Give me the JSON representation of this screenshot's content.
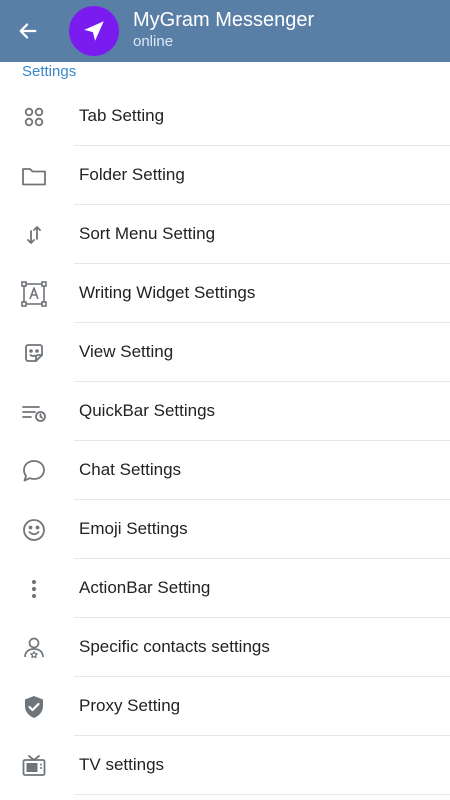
{
  "header": {
    "title": "MyGram Messenger",
    "status": "online",
    "colors": {
      "bar": "#5a7fa6",
      "avatar": "#7a1cf0",
      "section": "#3a87c8"
    }
  },
  "section": {
    "title": "Settings"
  },
  "items": [
    {
      "label": "Tab Setting",
      "icon": "grid-circles-icon"
    },
    {
      "label": "Folder Setting",
      "icon": "folder-icon"
    },
    {
      "label": "Sort Menu Setting",
      "icon": "sort-arrows-icon"
    },
    {
      "label": "Writing Widget Settings",
      "icon": "text-frame-icon"
    },
    {
      "label": "View Setting",
      "icon": "sticker-icon"
    },
    {
      "label": "QuickBar Settings",
      "icon": "list-clock-icon"
    },
    {
      "label": "Chat Settings",
      "icon": "chat-bubble-icon"
    },
    {
      "label": "Emoji Settings",
      "icon": "smile-icon"
    },
    {
      "label": "ActionBar Setting",
      "icon": "more-vertical-icon"
    },
    {
      "label": "Specific contacts settings",
      "icon": "contact-star-icon"
    },
    {
      "label": "Proxy Setting",
      "icon": "shield-check-icon"
    },
    {
      "label": "TV settings",
      "icon": "tv-icon"
    }
  ]
}
